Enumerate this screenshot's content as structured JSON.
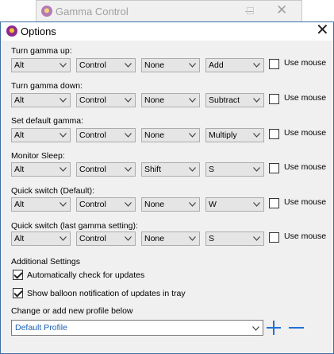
{
  "background_window": {
    "title": "Gamma Control"
  },
  "dialog": {
    "title": "Options"
  },
  "hotkeys": [
    {
      "label": "Turn gamma up:",
      "keys": [
        "Alt",
        "Control",
        "None",
        "Add"
      ],
      "use_mouse": "Use mouse",
      "use_mouse_checked": false
    },
    {
      "label": "Turn gamma down:",
      "keys": [
        "Alt",
        "Control",
        "None",
        "Subtract"
      ],
      "use_mouse": "Use mouse",
      "use_mouse_checked": false
    },
    {
      "label": "Set default gamma:",
      "keys": [
        "Alt",
        "Control",
        "None",
        "Multiply"
      ],
      "use_mouse": "Use mouse",
      "use_mouse_checked": false
    },
    {
      "label": "Monitor Sleep:",
      "keys": [
        "Alt",
        "Control",
        "Shift",
        "S"
      ],
      "use_mouse": "Use mouse",
      "use_mouse_checked": false
    },
    {
      "label": "Quick switch (Default):",
      "keys": [
        "Alt",
        "Control",
        "None",
        "W"
      ],
      "use_mouse": "Use mouse",
      "use_mouse_checked": false
    },
    {
      "label": "Quick switch (last gamma setting):",
      "keys": [
        "Alt",
        "Control",
        "None",
        "S"
      ],
      "use_mouse": "Use mouse",
      "use_mouse_checked": false
    }
  ],
  "additional": {
    "heading": "Additional Settings",
    "auto_update_label": "Automatically check for updates",
    "auto_update_checked": true,
    "balloon_label": "Show balloon notification of updates in tray",
    "balloon_checked": true
  },
  "profile": {
    "heading": "Change or add new profile below",
    "selected": "Default Profile"
  },
  "colors": {
    "accent": "#1e73d6",
    "profile_text": "#1a5fb4",
    "dialog_border": "#3f6fa5",
    "dialog_bg": "#f0f0f0"
  },
  "icons": {
    "app": "gamma-logo-icon",
    "close": "close-icon",
    "add_profile": "plus-icon",
    "remove_profile": "minus-icon"
  }
}
